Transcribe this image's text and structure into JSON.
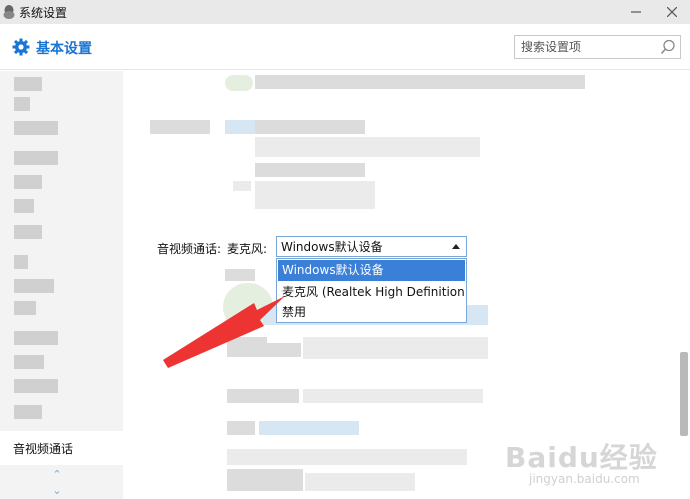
{
  "window": {
    "title": "系统设置",
    "minimize_icon": "minimize-icon",
    "close_icon": "close-icon"
  },
  "header": {
    "section_title": "基本设置",
    "search_placeholder": "搜索设置项"
  },
  "sidebar": {
    "active_item": "音视频通话"
  },
  "av_settings": {
    "section_label": "音视频通话:",
    "mic_label": "麦克风:",
    "selected_value": "Windows默认设备",
    "options": [
      "Windows默认设备",
      "麦克风 (Realtek High Definition",
      "禁用"
    ]
  },
  "colors": {
    "accent": "#1a76d2",
    "selection": "#3a7fd8",
    "annotation_arrow": "#ee3333"
  },
  "watermark": {
    "main": "Baidu经验",
    "sub": "jingyan.baidu.com"
  }
}
